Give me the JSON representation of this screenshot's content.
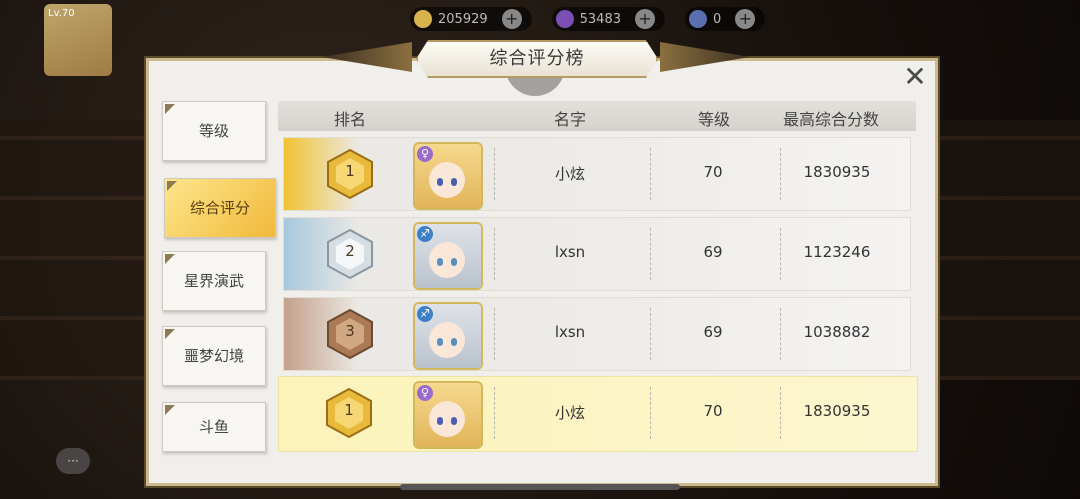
{
  "top": {
    "level": "Lv.70",
    "gold": "205929",
    "gems": "53483",
    "energy": "0"
  },
  "panel": {
    "title": "综合评分榜",
    "close": "✕"
  },
  "tabs": [
    {
      "label": "等级"
    },
    {
      "label": "综合评分"
    },
    {
      "label": "星界演武"
    },
    {
      "label": "噩梦幻境"
    },
    {
      "label": "斗鱼"
    }
  ],
  "table": {
    "headers": [
      "排名",
      "名字",
      "等级",
      "最高综合分数"
    ],
    "rows": [
      {
        "rank": "1",
        "name": "小炫",
        "level": "70",
        "score": "1830935"
      },
      {
        "rank": "2",
        "name": "lxsn",
        "level": "69",
        "score": "1123246"
      },
      {
        "rank": "3",
        "name": "lxsn",
        "level": "69",
        "score": "1038882"
      }
    ],
    "mine": {
      "rank": "1",
      "name": "小炫",
      "level": "70",
      "score": "1830935"
    }
  },
  "colors": {
    "gold_rank": "#f1c232",
    "silver_rank": "#a8c8dd",
    "bronze_rank": "#c4a18a",
    "active_tab": "#f6c94a"
  },
  "icons": {
    "close": "close-icon",
    "gold_badge": "gold-rank-badge-icon",
    "silver_badge": "silver-rank-badge-icon",
    "bronze_badge": "bronze-rank-badge-icon"
  }
}
